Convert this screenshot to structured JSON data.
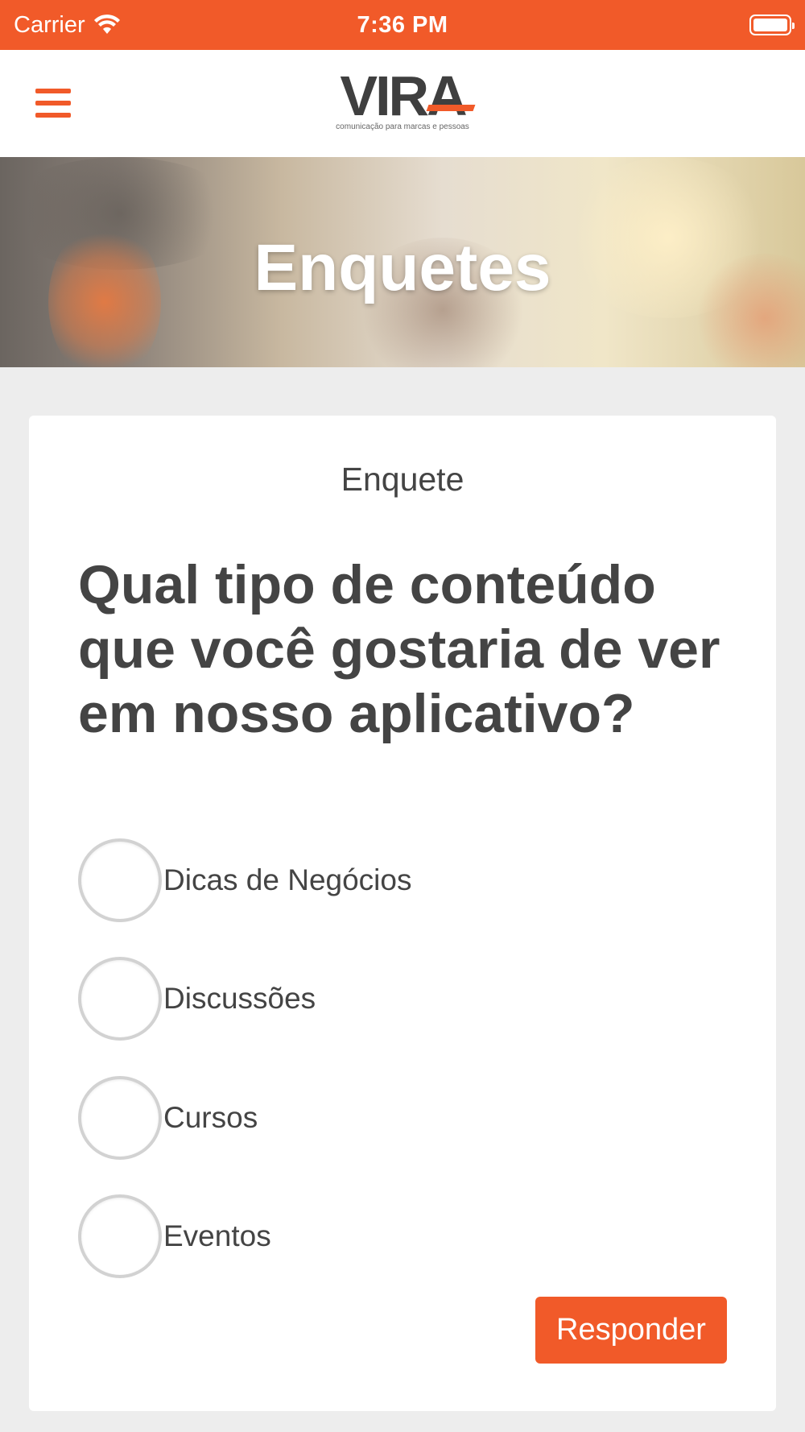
{
  "status_bar": {
    "carrier": "Carrier",
    "time": "7:36 PM",
    "wifi_icon": "wifi-icon",
    "battery_icon": "battery-icon"
  },
  "nav": {
    "menu_icon": "hamburger-menu-icon",
    "logo_text": "VIRA",
    "logo_tagline": "comunicação para marcas e pessoas"
  },
  "hero": {
    "title": "Enquetes"
  },
  "poll": {
    "label": "Enquete",
    "question": "Qual tipo de conteúdo que você gostaria de ver em nosso aplicativo?",
    "options": [
      {
        "label": "Dicas de Negócios",
        "selected": false
      },
      {
        "label": "Discussões",
        "selected": false
      },
      {
        "label": "Cursos",
        "selected": false
      },
      {
        "label": "Eventos",
        "selected": false
      }
    ],
    "submit_label": "Responder"
  },
  "colors": {
    "accent": "#f15a29",
    "text": "#444444",
    "background": "#ededed"
  }
}
